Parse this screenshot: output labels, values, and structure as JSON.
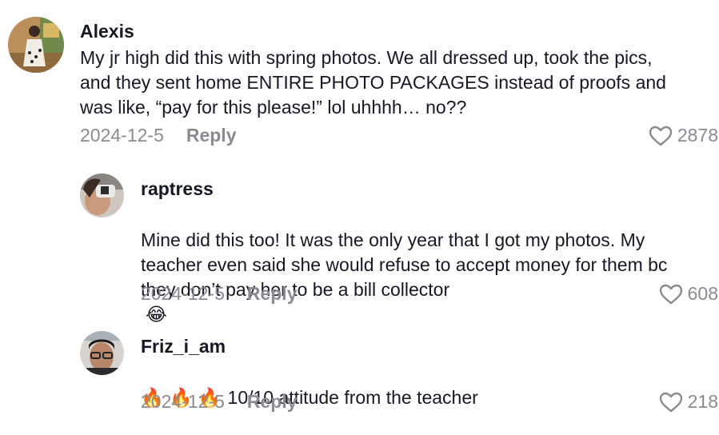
{
  "comments": [
    {
      "username": "Alexis",
      "text": "My jr high did this with spring photos. We all dressed up, took the pics,\nand they sent home ENTIRE PHOTO PACKAGES instead of proofs and\nwas like, “pay for this please!” lol uhhhh… no??",
      "date": "2024-12-5",
      "reply_label": "Reply",
      "likes": "2878",
      "avatar_icon": "avatar-photo"
    },
    {
      "username": "raptress",
      "text": "Mine did this too! It was the only year that I got my photos. My\nteacher even said she would refuse to accept money for them bc\nthey don’t pay her to be a bill collector",
      "emoji": "😂",
      "date": "2024-12-5",
      "reply_label": "Reply",
      "likes": "608",
      "avatar_icon": "avatar-photo"
    },
    {
      "username": "Friz_i_am",
      "emojis": "🔥 🔥 🔥",
      "text": "10/10 attitude from the teacher",
      "date": "2024-12-5",
      "reply_label": "Reply",
      "likes": "218",
      "avatar_icon": "avatar-photo"
    }
  ],
  "colors": {
    "text": "#161823",
    "muted": "#8a8b91",
    "fire": "#ff5a1f"
  }
}
